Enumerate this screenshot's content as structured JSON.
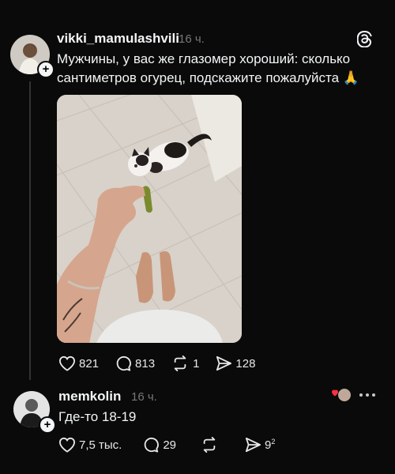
{
  "post": {
    "username": "vikki_mamulashvili",
    "time": "16 ч.",
    "text_line1": "Мужчины, у вас же глазомер хороший: сколько",
    "text_line2": "сантиметров огурец, подскажите пожалуйста",
    "emoji": "🙏",
    "likes": "821",
    "comments": "813",
    "reposts": "1",
    "shares": "128"
  },
  "reply": {
    "username": "memkolin",
    "time": "16 ч.",
    "text": "Где-то 18-19",
    "likes": "7,5 тыс.",
    "comments": "29",
    "shares": "9",
    "shares_sup": "2"
  },
  "icons": {
    "threads_logo": "threads-logo-icon",
    "more": "more-icon",
    "like": "heart-icon",
    "comment": "comment-icon",
    "repost": "repost-icon",
    "share": "send-icon"
  },
  "colors": {
    "background": "#0a0a0a",
    "text": "#f3f5f7",
    "muted": "#777777",
    "like_red": "#ff3040"
  }
}
